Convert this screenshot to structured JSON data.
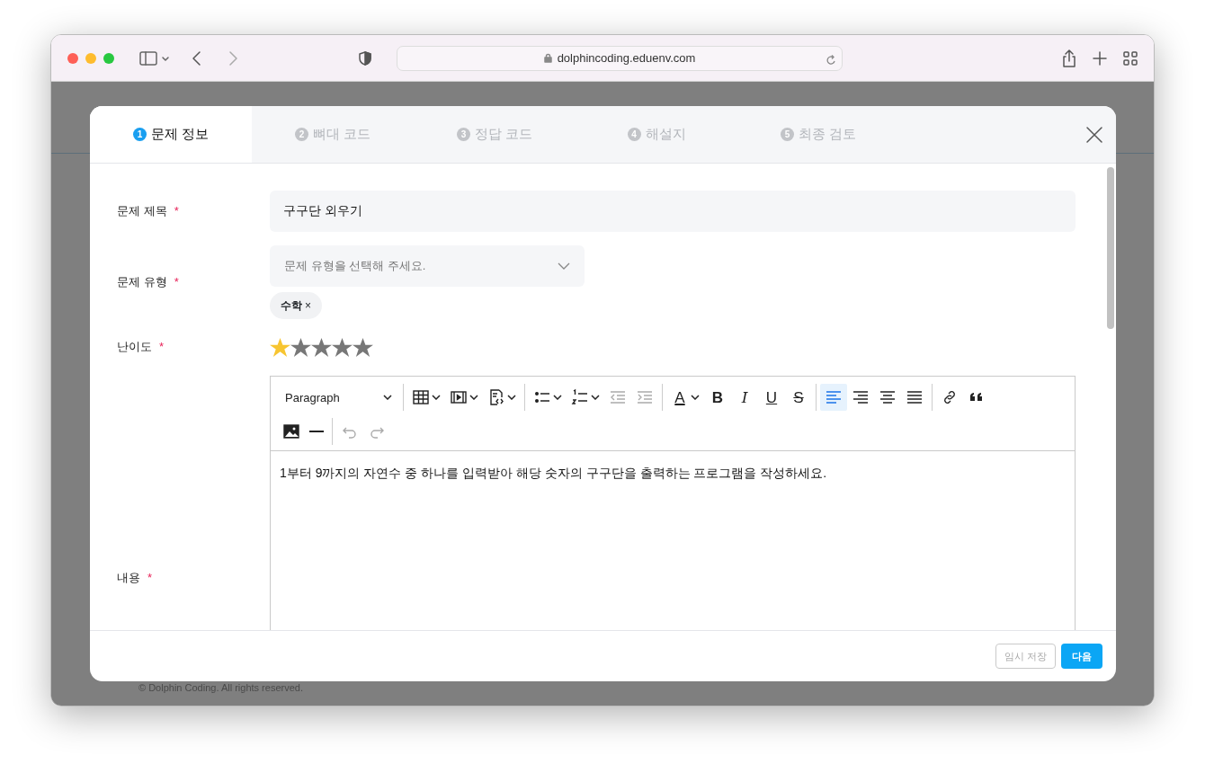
{
  "browser": {
    "url": "dolphincoding.eduenv.com"
  },
  "background": {
    "footer_text": "© Dolphin Coding. All rights reserved."
  },
  "tabs": [
    {
      "number": "1",
      "label": "문제 정보",
      "selected": true
    },
    {
      "number": "2",
      "label": "뼈대 코드",
      "selected": false
    },
    {
      "number": "3",
      "label": "정답 코드",
      "selected": false
    },
    {
      "number": "4",
      "label": "해설지",
      "selected": false
    },
    {
      "number": "5",
      "label": "최종 검토",
      "selected": false
    }
  ],
  "form": {
    "title_label": "문제 제목",
    "title_value": "구구단 외우기",
    "type_label": "문제 유형",
    "type_placeholder": "문제 유형을 선택해 주세요.",
    "type_tags": [
      {
        "label": "수학",
        "remove": "×"
      }
    ],
    "difficulty_label": "난이도",
    "stars": 1,
    "content_label": "내용",
    "required_mark": "*",
    "content_text": "1부터 9까지의 자연수 중 하나를 입력받아 해당 숫자의 구구단을 출력하는 프로그램을 작성하세요."
  },
  "toolbar": {
    "rows": [
      {
        "groups": [
          {
            "buttons": [
              {
                "kind": "select",
                "label": "Paragraph"
              }
            ]
          },
          {
            "buttons": [
              {
                "kind": "icon",
                "disabled": false,
                "selected": false
              },
              {
                "kind": "icon",
                "disabled": false,
                "selected": false
              },
              {
                "kind": "icon",
                "disabled": false,
                "selected": false
              }
            ]
          },
          {
            "buttons": [
              {
                "kind": "icon",
                "disabled": false,
                "selected": false
              },
              {
                "kind": "icon",
                "disabled": false,
                "selected": false
              },
              {
                "kind": "icon",
                "disabled": true,
                "selected": false
              },
              {
                "kind": "icon",
                "disabled": true,
                "selected": false
              }
            ]
          },
          {
            "buttons": [
              {
                "kind": "glyph",
                "glyph": "A",
                "disabled": false,
                "selected": false
              },
              {
                "kind": "glyph",
                "glyph": "B",
                "disabled": false,
                "selected": false
              },
              {
                "kind": "glyph",
                "glyph": "I",
                "disabled": false,
                "selected": false
              },
              {
                "kind": "glyph",
                "glyph": "U",
                "disabled": false,
                "selected": false
              },
              {
                "kind": "glyph",
                "glyph": "S",
                "disabled": false,
                "selected": false
              }
            ]
          },
          {
            "buttons": [
              {
                "kind": "icon",
                "disabled": false,
                "selected": true
              },
              {
                "kind": "icon",
                "disabled": false,
                "selected": false
              },
              {
                "kind": "icon",
                "disabled": false,
                "selected": false
              },
              {
                "kind": "icon",
                "disabled": false,
                "selected": false
              }
            ]
          },
          {
            "buttons": [
              {
                "kind": "icon",
                "disabled": false,
                "selected": false
              },
              {
                "kind": "icon",
                "disabled": false,
                "selected": false
              }
            ]
          }
        ]
      },
      {
        "groups": [
          {
            "buttons": [
              {
                "kind": "icon",
                "disabled": false,
                "selected": false
              },
              {
                "kind": "icon",
                "disabled": false,
                "selected": false
              }
            ]
          },
          {
            "buttons": [
              {
                "kind": "icon",
                "disabled": true,
                "selected": false
              },
              {
                "kind": "icon",
                "disabled": true,
                "selected": false
              }
            ]
          }
        ]
      }
    ]
  },
  "footer": {
    "save_draft": "임시 저장",
    "next": "다음"
  }
}
